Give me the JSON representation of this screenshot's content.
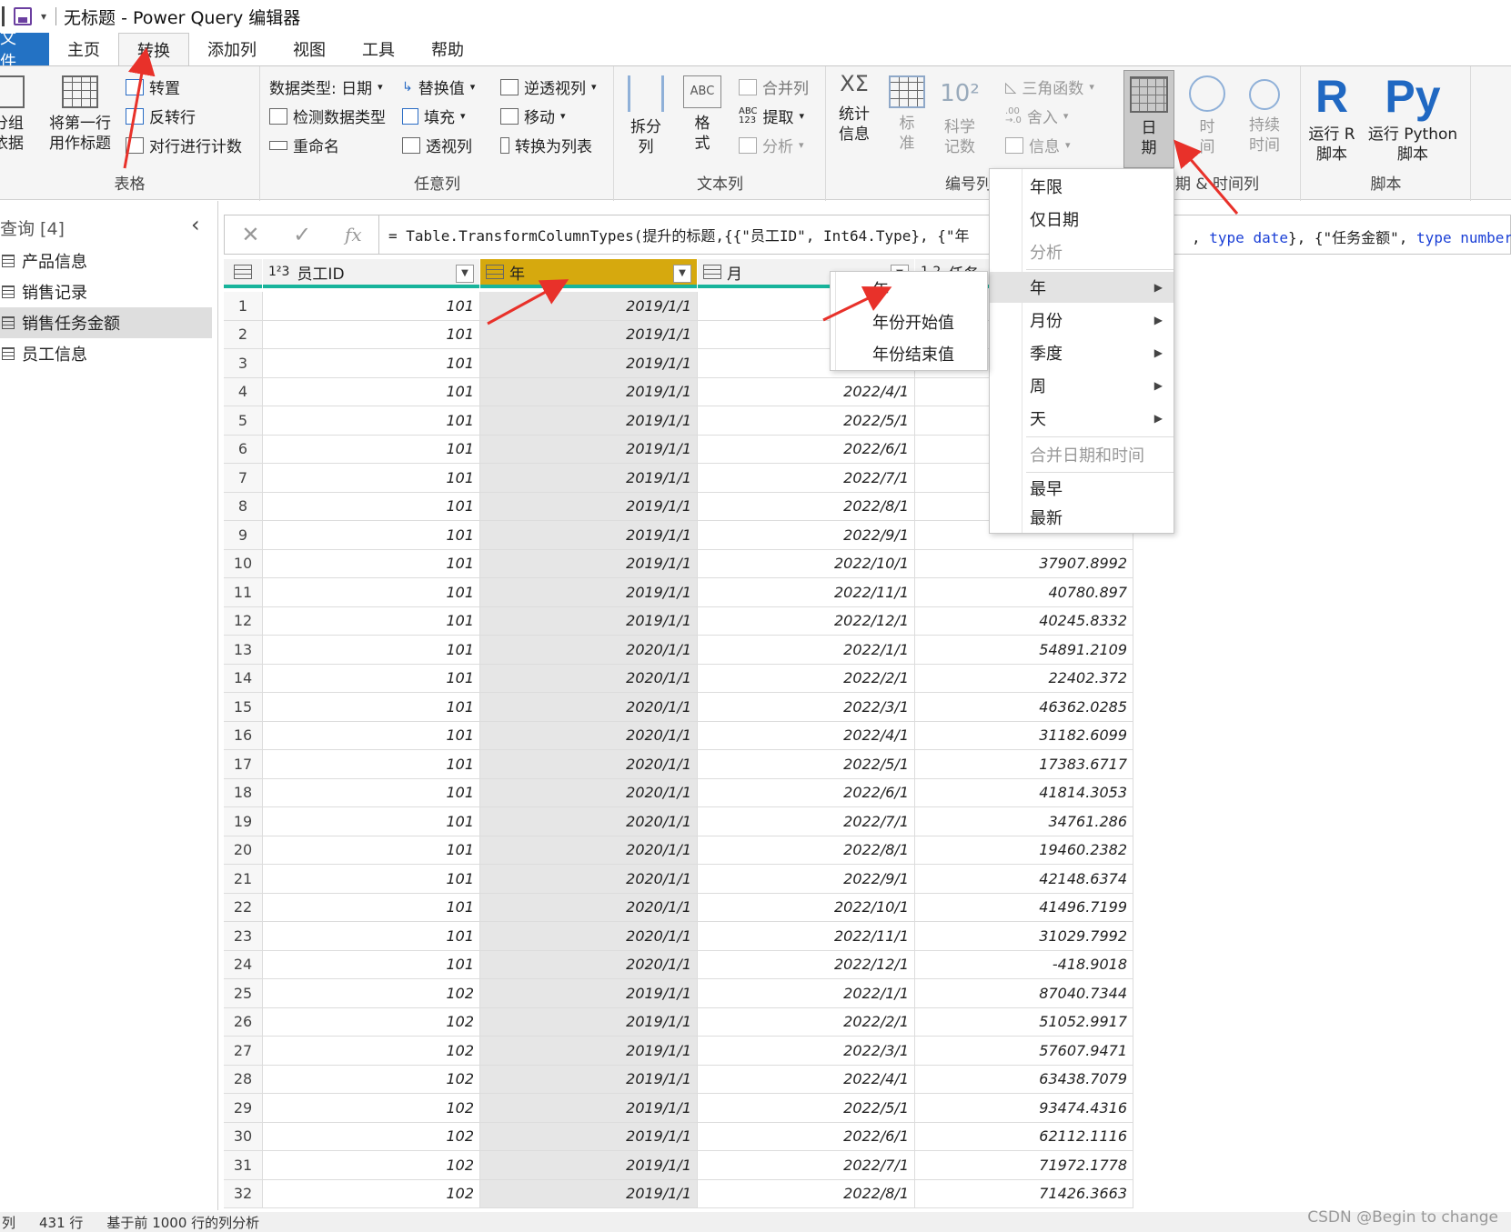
{
  "window": {
    "title": "无标题 - Power Query 编辑器"
  },
  "tabs": [
    {
      "label": "文件"
    },
    {
      "label": "主页"
    },
    {
      "label": "转换"
    },
    {
      "label": "添加列"
    },
    {
      "label": "视图"
    },
    {
      "label": "工具"
    },
    {
      "label": "帮助"
    }
  ],
  "ribbon": {
    "table_group": {
      "label": "表格",
      "group_by": "分组\n依据",
      "use_first_row": "将第一行\n用作标题",
      "transpose": "转置",
      "reverse_rows": "反转行",
      "count_rows": "对行进行计数"
    },
    "any_column": {
      "label": "任意列",
      "data_type": "数据类型: 日期",
      "detect_type": "检测数据类型",
      "rename": "重命名",
      "replace_values": "替换值",
      "fill": "填充",
      "pivot": "透视列",
      "unpivot": "逆透视列",
      "move": "移动",
      "to_list": "转换为列表"
    },
    "text_column": {
      "label": "文本列",
      "split": "拆分\n列",
      "format": "格\n式",
      "merge": "合并列",
      "extract": "提取",
      "parse": "分析"
    },
    "number_column": {
      "label": "编号列",
      "statistics": "统计\n信息",
      "standard": "标\n准",
      "scientific": "科学\n记数",
      "trig": "三角函数",
      "round": "舍入",
      "info": "信息"
    },
    "datetime_column": {
      "label": "日期 & 时间列",
      "date": "日\n期",
      "time": "时\n间",
      "duration": "持续\n时间"
    },
    "scripts": {
      "label": "脚本",
      "run_r": "运行 R\n脚本",
      "run_python": "运行 Python\n脚本",
      "r_glyph": "R",
      "py_glyph": "Py"
    }
  },
  "queries": {
    "title": "查询 [4]",
    "items": [
      {
        "label": "产品信息"
      },
      {
        "label": "销售记录"
      },
      {
        "label": "销售任务金额",
        "selected": true
      },
      {
        "label": "员工信息"
      }
    ]
  },
  "formula": {
    "text_head": "= Table.TransformColumnTypes(提升的标题,{{\"员工ID\", Int64.Type}, {\"年",
    "text_tail_kw1": "type",
    "text_tail_v1": "date",
    "text_tail_mid": "}, {\"任务金额\", ",
    "text_tail_kw2": "type",
    "text_tail_v2": "number"
  },
  "grid": {
    "columns": [
      {
        "name": "员工ID",
        "type_icon": "123"
      },
      {
        "name": "年",
        "type_icon": "calendar",
        "selected": true
      },
      {
        "name": "月",
        "type_icon": "calendar"
      },
      {
        "name": "任务",
        "type_icon": "1.2"
      }
    ],
    "rows": [
      [
        "101",
        "2019/1/1",
        "",
        ""
      ],
      [
        "101",
        "2019/1/1",
        "",
        ""
      ],
      [
        "101",
        "2019/1/1",
        "",
        ""
      ],
      [
        "101",
        "2019/1/1",
        "2022/4/1",
        ""
      ],
      [
        "101",
        "2019/1/1",
        "2022/5/1",
        ""
      ],
      [
        "101",
        "2019/1/1",
        "2022/6/1",
        ""
      ],
      [
        "101",
        "2019/1/1",
        "2022/7/1",
        ""
      ],
      [
        "101",
        "2019/1/1",
        "2022/8/1",
        ""
      ],
      [
        "101",
        "2019/1/1",
        "2022/9/1",
        ""
      ],
      [
        "101",
        "2019/1/1",
        "2022/10/1",
        "37907.8992"
      ],
      [
        "101",
        "2019/1/1",
        "2022/11/1",
        "40780.897"
      ],
      [
        "101",
        "2019/1/1",
        "2022/12/1",
        "40245.8332"
      ],
      [
        "101",
        "2020/1/1",
        "2022/1/1",
        "54891.2109"
      ],
      [
        "101",
        "2020/1/1",
        "2022/2/1",
        "22402.372"
      ],
      [
        "101",
        "2020/1/1",
        "2022/3/1",
        "46362.0285"
      ],
      [
        "101",
        "2020/1/1",
        "2022/4/1",
        "31182.6099"
      ],
      [
        "101",
        "2020/1/1",
        "2022/5/1",
        "17383.6717"
      ],
      [
        "101",
        "2020/1/1",
        "2022/6/1",
        "41814.3053"
      ],
      [
        "101",
        "2020/1/1",
        "2022/7/1",
        "34761.286"
      ],
      [
        "101",
        "2020/1/1",
        "2022/8/1",
        "19460.2382"
      ],
      [
        "101",
        "2020/1/1",
        "2022/9/1",
        "42148.6374"
      ],
      [
        "101",
        "2020/1/1",
        "2022/10/1",
        "41496.7199"
      ],
      [
        "101",
        "2020/1/1",
        "2022/11/1",
        "31029.7992"
      ],
      [
        "101",
        "2020/1/1",
        "2022/12/1",
        "-418.9018"
      ],
      [
        "102",
        "2019/1/1",
        "2022/1/1",
        "87040.7344"
      ],
      [
        "102",
        "2019/1/1",
        "2022/2/1",
        "51052.9917"
      ],
      [
        "102",
        "2019/1/1",
        "2022/3/1",
        "57607.9471"
      ],
      [
        "102",
        "2019/1/1",
        "2022/4/1",
        "63438.7079"
      ],
      [
        "102",
        "2019/1/1",
        "2022/5/1",
        "93474.4316"
      ],
      [
        "102",
        "2019/1/1",
        "2022/6/1",
        "62112.1116"
      ],
      [
        "102",
        "2019/1/1",
        "2022/7/1",
        "71972.1778"
      ],
      [
        "102",
        "2019/1/1",
        "2022/8/1",
        "71426.3663"
      ]
    ]
  },
  "date_menu": {
    "items": [
      {
        "label": "年限",
        "disabled": false
      },
      {
        "label": "仅日期",
        "disabled": false
      },
      {
        "label": "分析",
        "disabled": true
      },
      {
        "label": "年",
        "submenu": true,
        "highlighted": true
      },
      {
        "label": "月份",
        "submenu": true
      },
      {
        "label": "季度",
        "submenu": true
      },
      {
        "label": "周",
        "submenu": true
      },
      {
        "label": "天",
        "submenu": true
      },
      {
        "label": "合并日期和时间",
        "disabled": true
      },
      {
        "label": "最早"
      },
      {
        "label": "最新"
      }
    ]
  },
  "year_submenu": {
    "items": [
      {
        "label": "年"
      },
      {
        "label": "年份开始值"
      },
      {
        "label": "年份结束值"
      }
    ]
  },
  "status": {
    "columns": "列",
    "rows": "431 行",
    "profile": "基于前 1000 行的列分析"
  },
  "watermark": "CSDN @Begin to change",
  "colors": {
    "accent_blue": "#2372c4",
    "selected_header": "#d6a90e",
    "header_underline": "#17b49b",
    "annotation_red": "#e8312a"
  }
}
